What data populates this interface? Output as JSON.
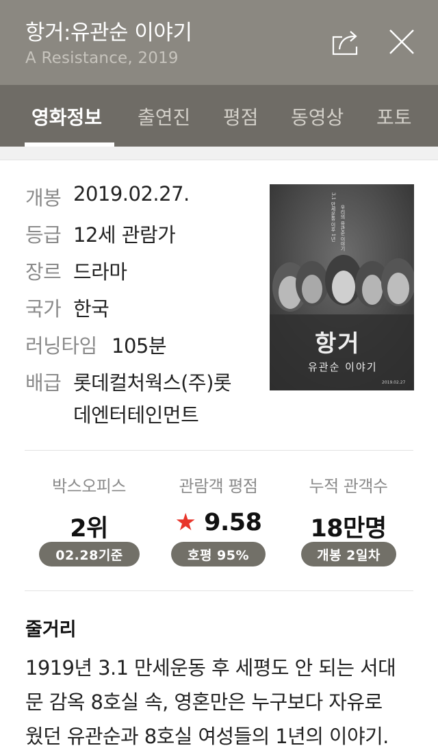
{
  "header": {
    "title": "항거:유관순 이야기",
    "subtitle": "A Resistance, 2019"
  },
  "tabs": [
    {
      "label": "영화정보",
      "active": true
    },
    {
      "label": "출연진",
      "active": false
    },
    {
      "label": "평점",
      "active": false
    },
    {
      "label": "동영상",
      "active": false
    },
    {
      "label": "포토",
      "active": false
    }
  ],
  "info": {
    "release": {
      "label": "개봉",
      "value": "2019.02.27."
    },
    "rating": {
      "label": "등급",
      "value": "12세 관람가"
    },
    "genre": {
      "label": "장르",
      "value": "드라마"
    },
    "country": {
      "label": "국가",
      "value": "한국"
    },
    "runtime": {
      "label": "러닝타임",
      "value": "105분"
    },
    "distributor": {
      "label": "배급",
      "value_line1": "롯데컬처웍스(주)롯",
      "value_line2": "데엔터테인먼트"
    }
  },
  "poster": {
    "top_text_1": "3.1 만세운동 이후 1년",
    "top_text_2": "우리의 유관순 이야기",
    "title_big": "항거",
    "title_small": "유관순 이야기",
    "date": "2019.02.27"
  },
  "stats": {
    "boxoffice": {
      "label": "박스오피스",
      "value": "2위",
      "badge": "02.28기준"
    },
    "audience_rating": {
      "label": "관람객 평점",
      "star": "★",
      "value": "9.58",
      "badge": "호평 95%"
    },
    "cumulative": {
      "label": "누적 관객수",
      "value": "18만명",
      "badge": "개봉 2일차"
    }
  },
  "synopsis": {
    "title": "줄거리",
    "lines": [
      "1919년 3.1 만세운동 후 세평도 안 되는 서대",
      "문 감옥 8호실 속, 영혼만은 누구보다 자유로",
      "웠던 유관순과 8호실 여성들의 1년의 이야기."
    ]
  },
  "colors": {
    "header_bg": "#8b8881",
    "tabs_bg": "#6f6c66",
    "pill_bg": "#727068",
    "star": "#e8352b"
  },
  "icons": {
    "share": "share-icon",
    "close": "close-icon"
  }
}
